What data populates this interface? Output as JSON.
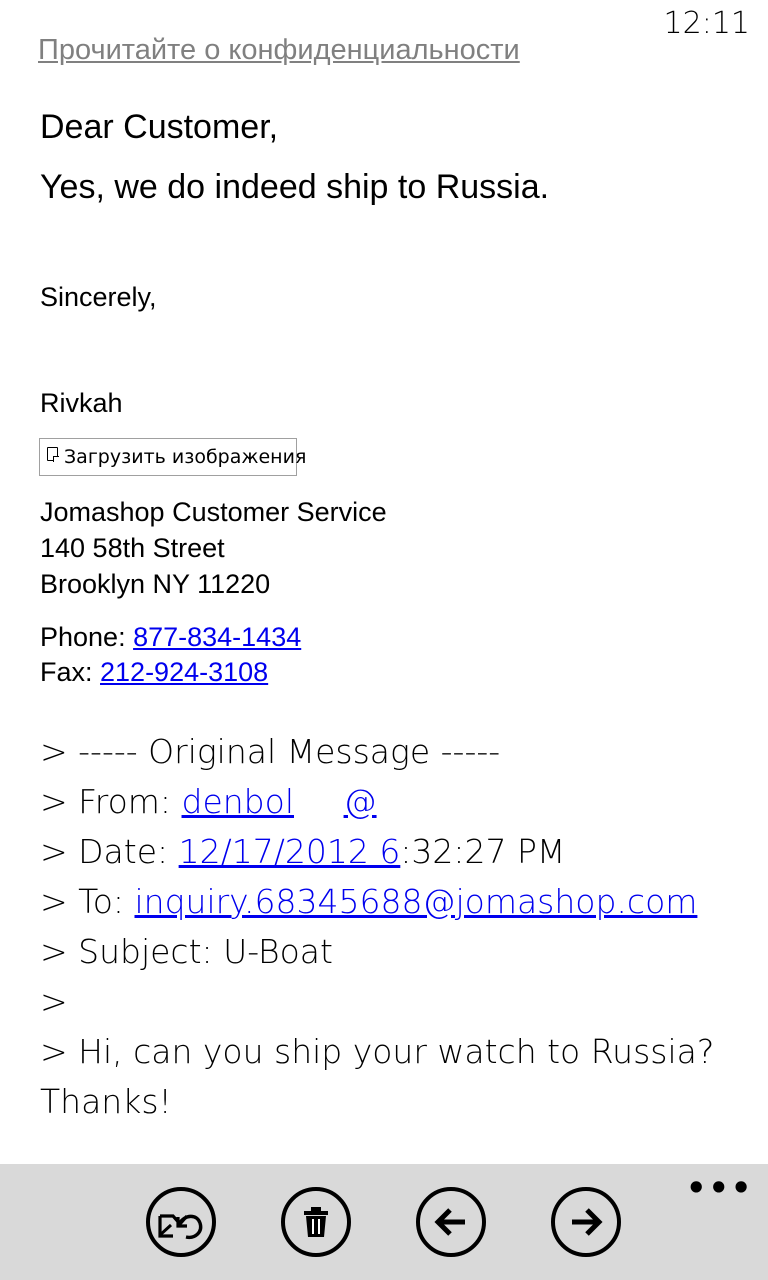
{
  "status": {
    "time": "12:11"
  },
  "email": {
    "privacy_link": "Прочитайте о конфиденциальности",
    "greeting": "Dear Customer,",
    "reply_line": "Yes, we do indeed ship to Russia.",
    "closing": "Sincerely,",
    "signer": "Rivkah",
    "load_images_label": "Загрузить изображения",
    "signature": {
      "company": "Jomashop Customer Service",
      "street": "140 58th Street",
      "city": "Brooklyn NY 11220",
      "phone_label": "Phone: ",
      "phone": "877-834-1434",
      "fax_label": "Fax: ",
      "fax": "212-924-3108"
    },
    "quoted": {
      "header": "> ----- Original Message -----",
      "from_label": "> From: ",
      "from_value_a": "denbol",
      "from_value_b": "@",
      "date_label": "> Date: ",
      "date_link": "12/17/2012 6",
      "date_rest": ":32:27 PM",
      "to_label": "> To: ",
      "to_value": "inquiry.68345688@jomashop.com",
      "subject": "> Subject: U-Boat",
      "blank": ">",
      "question": "> Hi, can you ship your watch to Russia?",
      "thanks": "Thanks!"
    }
  },
  "appbar": {
    "buttons": [
      "reply-icon",
      "trash-icon",
      "arrow-left-icon",
      "arrow-right-icon"
    ],
    "more_label": "•••"
  },
  "colors": {
    "link": "#0000ee",
    "appbar_bg": "#d9d9d9",
    "muted_link": "#808080"
  }
}
